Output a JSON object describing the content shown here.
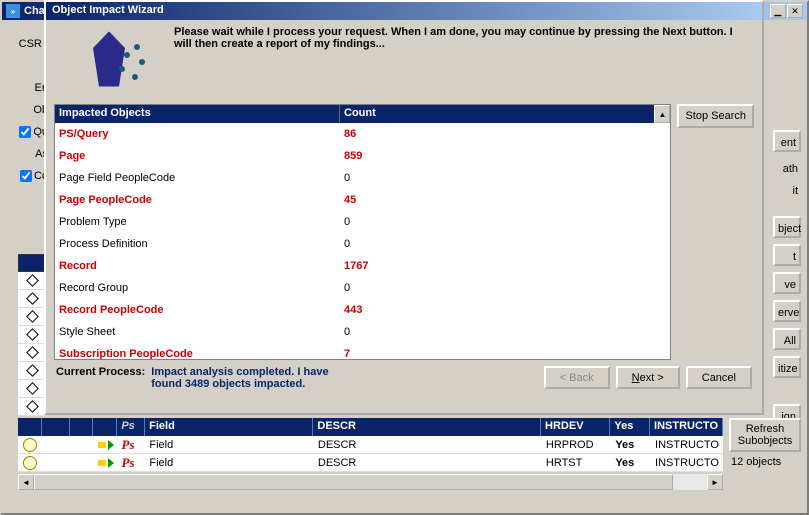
{
  "bg_window": {
    "title_prefix": "Cha",
    "min_icon": "▁",
    "close_icon": "✕"
  },
  "left_labels": {
    "csr": "CSR I",
    "en": "En",
    "ob": "Ob",
    "qu": "Qu",
    "as": "As",
    "co": "Co"
  },
  "right_btns": {
    "ent": "ent",
    "ath": "ath",
    "it": "it",
    "bject": "bject",
    "t": "t",
    "ve": "ve",
    "erve": "erve",
    "all": "All",
    "itize": "itize",
    "ign": "ign"
  },
  "wizard": {
    "title": "Object Impact Wizard",
    "header_text": "Please wait while I process your request.  When I am done, you may continue by pressing the Next button.  I will then create a report of my findings...",
    "col_impacted": "Impacted Objects",
    "col_count": "Count",
    "stop_btn": "Stop Search",
    "rows": [
      {
        "name": "PS/Query",
        "count": "86",
        "bold": true
      },
      {
        "name": "Page",
        "count": "859",
        "bold": true
      },
      {
        "name": "Page Field PeopleCode",
        "count": "0",
        "bold": false
      },
      {
        "name": "Page PeopleCode",
        "count": "45",
        "bold": true
      },
      {
        "name": "Problem Type",
        "count": "0",
        "bold": false
      },
      {
        "name": "Process Definition",
        "count": "0",
        "bold": false
      },
      {
        "name": "Record",
        "count": "1767",
        "bold": true
      },
      {
        "name": "Record Group",
        "count": "0",
        "bold": false
      },
      {
        "name": "Record PeopleCode",
        "count": "443",
        "bold": true
      },
      {
        "name": "Style Sheet",
        "count": "0",
        "bold": false
      },
      {
        "name": "Subscription PeopleCode",
        "count": "7",
        "bold": true
      }
    ],
    "current_process_label": "Current Process:",
    "current_process_msg": "Impact analysis completed. I have found 3489 objects impacted.",
    "back_btn": "< Back",
    "next_btn": "Next >",
    "cancel_btn": "Cancel"
  },
  "grid": {
    "h5": "Ps",
    "h6": "Field",
    "h7": "DESCR",
    "h8": "HRDEV",
    "h9": "Yes",
    "h10": "INSTRUCTO",
    "rows": [
      {
        "ps": "Ps",
        "type": "Field",
        "descr": "DESCR",
        "env": "HRPROD",
        "yes": "Yes",
        "instr": "INSTRUCTO"
      },
      {
        "ps": "Ps",
        "type": "Field",
        "descr": "DESCR",
        "env": "HRTST",
        "yes": "Yes",
        "instr": "INSTRUCTO"
      }
    ]
  },
  "refresh": {
    "btn": "Refresh Subobjects",
    "count": "12 objects"
  }
}
